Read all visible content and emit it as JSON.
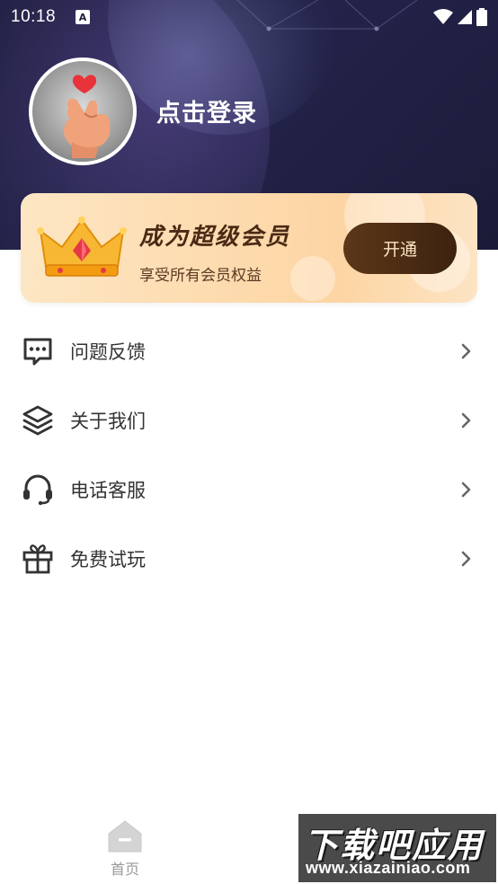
{
  "status_bar": {
    "time": "10:18",
    "notification_icon": "A"
  },
  "profile": {
    "login_label": "点击登录",
    "avatar_icon": "finger-heart-icon"
  },
  "vip": {
    "title": "成为超级会员",
    "subtitle": "享受所有会员权益",
    "button_label": "开通",
    "crown_icon": "crown-icon"
  },
  "menu": {
    "items": [
      {
        "label": "问题反馈",
        "icon": "message-dots-icon"
      },
      {
        "label": "关于我们",
        "icon": "layers-icon"
      },
      {
        "label": "电话客服",
        "icon": "headset-icon"
      },
      {
        "label": "免费试玩",
        "icon": "gift-icon"
      }
    ]
  },
  "bottom_nav": {
    "home_label": "首页",
    "home_icon": "home-icon"
  },
  "watermark": {
    "main": "下载吧应用",
    "url": "www.xiazainiao.com"
  },
  "colors": {
    "header_bg": "#1c1c3c",
    "vip_card_bg": "#fddcb0",
    "vip_button_bg": "#4a2a14",
    "text_primary": "#333333",
    "nav_inactive": "#999999"
  }
}
